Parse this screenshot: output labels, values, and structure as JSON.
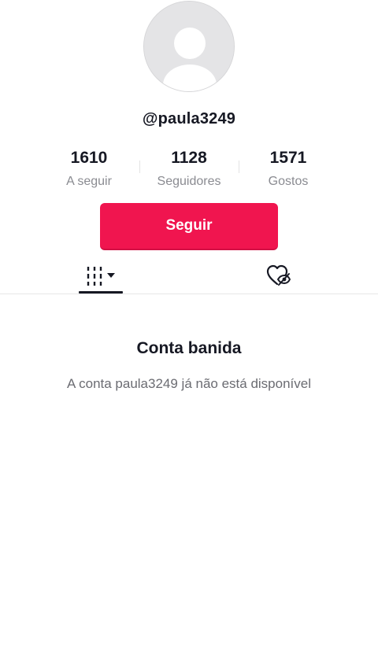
{
  "profile": {
    "username": "@paula3249",
    "avatar_icon": "default-avatar-icon"
  },
  "stats": {
    "following": {
      "value": "1610",
      "label": "A seguir"
    },
    "followers": {
      "value": "1128",
      "label": "Seguidores"
    },
    "likes": {
      "value": "1571",
      "label": "Gostos"
    }
  },
  "actions": {
    "follow_label": "Seguir",
    "accent_color": "#f0154f"
  },
  "tabs": {
    "videos_icon": "video-grid-icon",
    "liked_icon": "liked-hidden-icon",
    "selected": "videos"
  },
  "notice": {
    "title": "Conta banida",
    "message": "A conta paula3249 já não está disponível"
  }
}
